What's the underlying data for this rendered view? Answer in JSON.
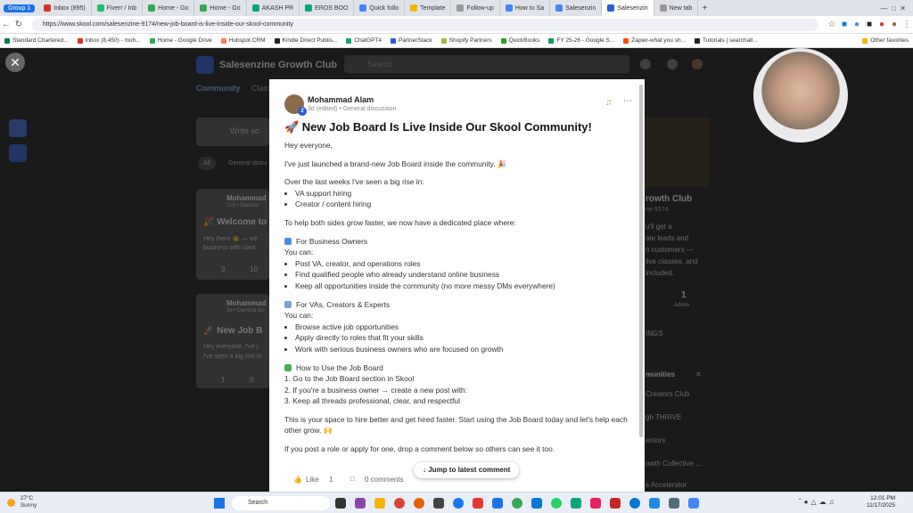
{
  "browser": {
    "group_label": "Group 1",
    "tabs": [
      {
        "label": "Inbox (895)",
        "color": "#d93025"
      },
      {
        "label": "Fiverr / Inb",
        "color": "#1dbf73"
      },
      {
        "label": "Home - Go",
        "color": "#34a853"
      },
      {
        "label": "Home - Go",
        "color": "#34a853"
      },
      {
        "label": "AKASH PR",
        "color": "#00a67e"
      },
      {
        "label": "EROS BOO",
        "color": "#00a67e"
      },
      {
        "label": "Quick follo",
        "color": "#4285f4"
      },
      {
        "label": "Template",
        "color": "#f4b400"
      },
      {
        "label": "Follow-up",
        "color": "#999999"
      },
      {
        "label": "How to Sa",
        "color": "#4285f4"
      },
      {
        "label": "Salesenzin",
        "color": "#4285f4"
      },
      {
        "label": "Salesenzin",
        "color": "#2a5bd7",
        "active": true
      },
      {
        "label": "New tab",
        "color": "#999999"
      }
    ],
    "url": "https://www.skool.com/salesenzine-9174/new-job-board-is-live-inside-our-skool-community",
    "bookmarks": [
      {
        "label": "Standard Chartered...",
        "color": "#0a7c3e"
      },
      {
        "label": "Inbox (8,450) - moh...",
        "color": "#d93025"
      },
      {
        "label": "Home - Google Drive",
        "color": "#34a853"
      },
      {
        "label": "Hubspot CRM",
        "color": "#ff7a59"
      },
      {
        "label": "Kindle Direct Publis...",
        "color": "#222222"
      },
      {
        "label": "ChatGPT4",
        "color": "#10a37f"
      },
      {
        "label": "PartnerStack",
        "color": "#2a5bd7"
      },
      {
        "label": "Shopify Partners",
        "color": "#95bf47"
      },
      {
        "label": "QuickBooks",
        "color": "#2ca01c"
      },
      {
        "label": "FY 25-26 - Google S...",
        "color": "#0f9d58"
      },
      {
        "label": "Zapier-what you sh...",
        "color": "#ff4a00"
      },
      {
        "label": "Tutorials | searchatl...",
        "color": "#222222"
      }
    ],
    "other_favorites": "Other favorites"
  },
  "site": {
    "name": "Salesenzine Growth Club",
    "search_placeholder": "Search",
    "nav_community": "Community",
    "nav_classroom": "Classr",
    "write_placeholder": "Write so",
    "filter_all": "All",
    "filter_general": "General discu",
    "feed_author": "Mohammad",
    "feed_meta": "11d • General",
    "feed_title_1": "🎉 Welcome to",
    "feed_snippet_1": "Hey there 👋 — we",
    "feed_snippet_1b": "business with clarit",
    "feed_likes_1": "3",
    "feed_comments_1": "10",
    "feed_author_2": "Mohammad",
    "feed_meta_2": "3d • General dis",
    "feed_title_2": "🚀 New Job B",
    "feed_snippet_2": "Hey everyone, I've j",
    "feed_snippet_2b": "I've seen a big rise in",
    "feed_likes_2": "1",
    "feed_comments_2": "0",
    "right_group": "rowth Club",
    "right_slug": "ne-9174",
    "right_desc_1": "u'll get a",
    "right_desc_2": "ate leads and",
    "right_desc_3": "n customers —",
    "right_desc_4": "live classes, and",
    "right_desc_5": "included.",
    "right_admins": "1",
    "right_admins_label": "Admin",
    "right_settings": "INGS",
    "communities_header": "munities",
    "community_1": "Creators Club",
    "community_2": "gh THRIVE",
    "community_3": "entors",
    "community_4": "owth Collective ...",
    "community_5": "s Accelerator"
  },
  "post": {
    "author": "Mohammad Alam",
    "badge_level": "2",
    "meta": "3d (edited) • General discussion",
    "title": "🚀 New Job Board Is Live Inside Our Skool Community!",
    "greeting": "Hey everyone,",
    "intro": "I've just launched a brand-new Job Board inside the community. 🎉",
    "rise_line": "Over the last weeks I've seen a big rise in:",
    "rise_items": [
      "VA support hiring",
      "Creator / content hiring"
    ],
    "purpose": "To help both sides grow faster, we now have a dedicated place where:",
    "owners_header": "For Business Owners",
    "owners_can": "You can:",
    "owners_items": [
      "Post VA, creator, and operations roles",
      "Find qualified people who already understand online business",
      "Keep all opportunities inside the community (no more messy DMs everywhere)"
    ],
    "vas_header": "For VAs, Creators & Experts",
    "vas_can": "You can:",
    "vas_items": [
      "Browse active job opportunities",
      "Apply directly to roles that fit your skills",
      "Work with serious business owners who are focused on growth"
    ],
    "howto_header": "How to Use the Job Board",
    "howto_steps": [
      "1. Go to the Job Board section in Skool",
      "2. If you're a business owner → create a new post with:",
      "3. Keep all threads professional, clear, and respectful"
    ],
    "closing": "This is your space to hire better and get hired faster. Start using the Job Board today and let's help each other grow. 🙌",
    "cta": "If you post a role or apply for one, drop a comment below so others can see it too.",
    "like_label": "Like",
    "like_count": "1",
    "comments_label": "0 comments",
    "jump_label": "Jump to latest comment"
  },
  "taskbar": {
    "temp": "27°C",
    "weather": "Sunny",
    "search": "Search",
    "time": "12:01 PM",
    "date": "11/17/2025"
  }
}
